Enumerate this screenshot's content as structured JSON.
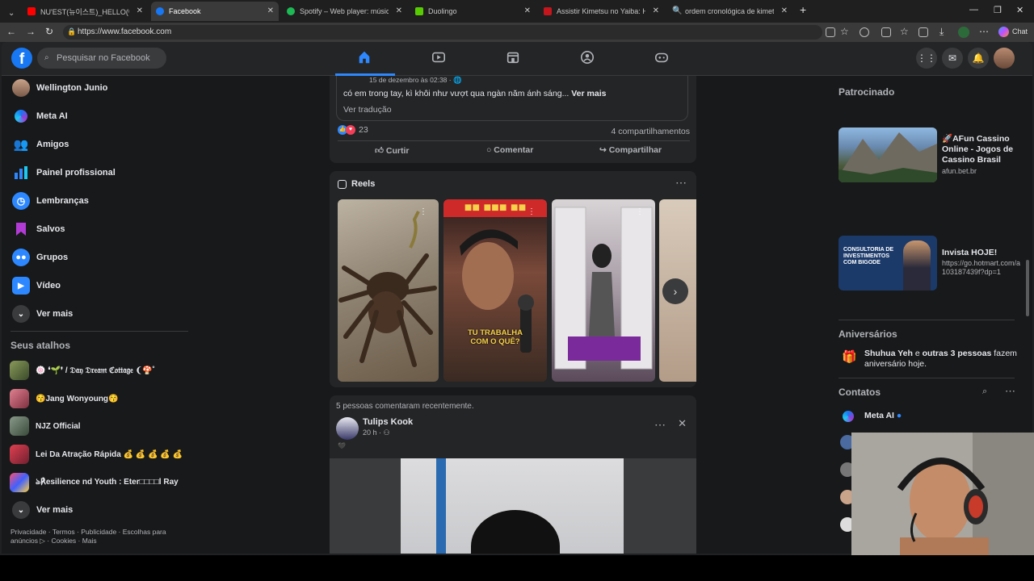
{
  "browser": {
    "tabs": [
      {
        "title": "NU'EST(뉴이스트)_HELLO(여보",
        "favicon_color": "#ff0000",
        "active": false
      },
      {
        "title": "Facebook",
        "favicon_color": "#1877f2",
        "active": true
      },
      {
        "title": "Spotify – Web player: música para",
        "favicon_color": "#1db954",
        "active": false
      },
      {
        "title": "Duolingo",
        "favicon_color": "#58cc02",
        "active": false
      },
      {
        "title": "Assistir Kimetsu no Yaiba: Hashira",
        "favicon_color": "#c4161c",
        "active": false
      },
      {
        "title": "ordem cronológica de kimetsu no",
        "favicon_color": "#4a90e2",
        "active": false
      }
    ],
    "url": "https://www.facebook.com",
    "chat_label": "Chat"
  },
  "header": {
    "logo": "f",
    "search_placeholder": "Pesquisar no Facebook"
  },
  "sidebar": {
    "items": [
      {
        "label": "Wellington Junio",
        "icon": "avatar",
        "color": "#8a6a55"
      },
      {
        "label": "Meta AI",
        "icon": "meta-ai-icon",
        "color": "#1877f2"
      },
      {
        "label": "Amigos",
        "icon": "friends-icon",
        "color": "#1877f2"
      },
      {
        "label": "Painel profissional",
        "icon": "dashboard-icon",
        "color": "#1877f2"
      },
      {
        "label": "Lembranças",
        "icon": "clock-icon",
        "color": "#1877f2"
      },
      {
        "label": "Salvos",
        "icon": "bookmark-icon",
        "color": "#9b3bd6"
      },
      {
        "label": "Grupos",
        "icon": "groups-icon",
        "color": "#1877f2"
      },
      {
        "label": "Vídeo",
        "icon": "video-icon",
        "color": "#1877f2"
      },
      {
        "label": "Ver mais",
        "icon": "chevron-down-icon",
        "color": "#3a3b3c"
      }
    ],
    "shortcuts_title": "Seus atalhos",
    "shortcuts": [
      {
        "label": "🍥 ❛🌱❜ / 𝔇𝔞𝔶 𝔇𝔯𝔢𝔞𝔪 ℭ𝔬𝔱𝔱𝔞𝔤𝔢 ❨🍄˚",
        "color": "#7a8a4a"
      },
      {
        "label": "😚Jang Wonyoung😚",
        "color": "#c06070"
      },
      {
        "label": "NJZ Official",
        "color": "#5a6a5a"
      },
      {
        "label": "Lei Da Atração Rápida 💰 💰 💰 💰 💰",
        "color": "#c03040"
      },
      {
        "label": "ঌ℟esilience nd Youth : Eter□□□□l Ray",
        "color": "#d04060"
      }
    ],
    "shortcuts_more": "Ver mais",
    "footer": "Privacidade · Termos · Publicidade · Escolhas para anúncios ▷ · Cookies · Mais"
  },
  "feed": {
    "post1": {
      "quoted_time": "15 de dezembro às 02:38 · ",
      "quoted_text": "có em trong tay, kì khôi như vượt qua ngàn năm ánh sáng...",
      "see_more": "Ver mais",
      "translate": "Ver tradução",
      "reactions_count": "23",
      "shares": "4 compartilhamentos",
      "like": "Curtir",
      "comment": "Comentar",
      "share": "Compartilhar"
    },
    "reels": {
      "title": "Reels",
      "items": [
        {
          "colors": [
            "#a89a85",
            "#6b5d4c"
          ],
          "caption": ""
        },
        {
          "colors": [
            "#7a5a4a",
            "#2a2a2a"
          ],
          "caption": "TU TRABALHA COM O QUÊ?"
        },
        {
          "colors": [
            "#c8c4c6",
            "#8a7a8a"
          ],
          "caption": ""
        },
        {
          "colors": [
            "#c9b9a9",
            "#a08a78"
          ],
          "caption": ""
        }
      ]
    },
    "post2": {
      "activity": "5 pessoas comentaram recentemente.",
      "author": "Tulips Kook",
      "time": "20 h · ",
      "emoji": "🖤"
    }
  },
  "right": {
    "sponsored_title": "Patrocinado",
    "ads": [
      {
        "title": "🚀AFun Cassino Online - Jogos de Cassino Brasil",
        "url": "afun.bet.br"
      },
      {
        "title": "Invista HOJE!",
        "url": "https://go.hotmart.com/a103187439f?dp=1"
      }
    ],
    "birthdays_title": "Aniversários",
    "birthday_name": "Shuhua Yeh",
    "birthday_mid": " e ",
    "birthday_others": "outras 3 pessoas",
    "birthday_rest": " fazem aniversário hoje.",
    "contacts_title": "Contatos",
    "contacts": [
      {
        "name": "Meta AI"
      }
    ]
  }
}
